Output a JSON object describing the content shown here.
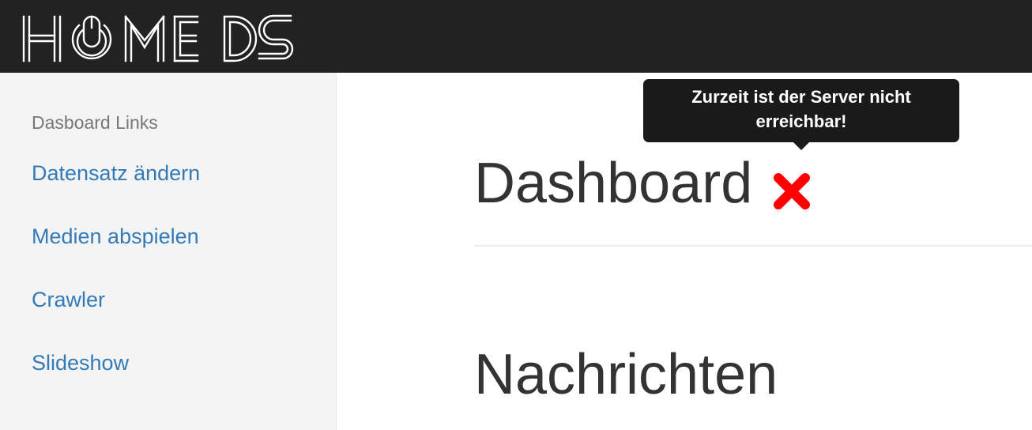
{
  "header": {
    "logo_text": "HOME DS",
    "logo_icon": "computer-mouse-icon"
  },
  "sidebar": {
    "heading": "Dasboard Links",
    "items": [
      {
        "label": "Datensatz ändern"
      },
      {
        "label": "Medien abspielen"
      },
      {
        "label": "Crawler"
      },
      {
        "label": "Slideshow"
      }
    ]
  },
  "main": {
    "title": "Dashboard",
    "status_icon": "red-x-icon",
    "section_title": "Nachrichten"
  },
  "tooltip": {
    "text": "Zurzeit ist der Server nicht erreichbar!"
  },
  "colors": {
    "navbar_bg": "#222222",
    "sidebar_bg": "#f4f4f4",
    "link": "#337ab7",
    "error": "#ff0000"
  }
}
